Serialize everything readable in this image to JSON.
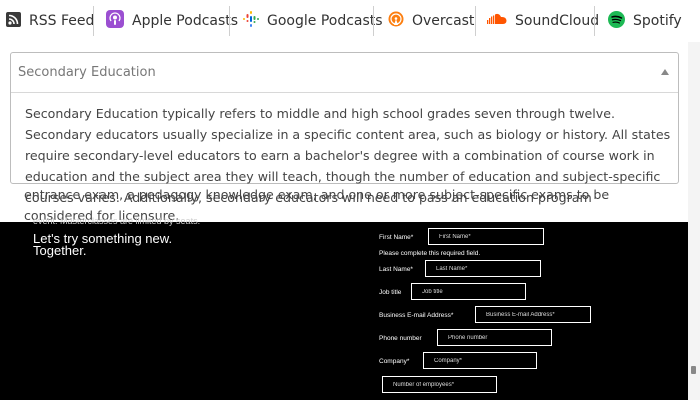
{
  "podcast_bar": {
    "items": [
      {
        "label": "RSS Feed",
        "icon": "rss-icon"
      },
      {
        "label": "Apple Podcasts",
        "icon": "apple-podcasts-icon"
      },
      {
        "label": "Google Podcasts",
        "icon": "google-podcasts-icon"
      },
      {
        "label": "Overcast",
        "icon": "overcast-icon"
      },
      {
        "label": "SoundCloud",
        "icon": "soundcloud-icon"
      },
      {
        "label": "Spotify",
        "icon": "spotify-icon"
      }
    ]
  },
  "accordion": {
    "title": "Secondary Education",
    "body": "Secondary Education typically refers to middle and high school grades seven through twelve. Secondary educators usually specialize in a specific content area, such as biology or history. All states require secondary-level educators to earn a bachelor's degree with a combination of course work in education and the subject area they will teach, though the number of education and subject-specific courses varies. Additionally, secondary educators will need to pass an education program",
    "overflow": "entrance exam, a pedagogy knowledge exam, and one or more subject-specific exams to be considered for licensure."
  },
  "form_section": {
    "cut_text": "event. Masterclasses are limited by seats.",
    "tagline_1": "Let's try something new.",
    "tagline_2": "Together.",
    "fields": {
      "first_name": {
        "label": "First Name*",
        "placeholder": "First Name*",
        "error": "Please complete this required field."
      },
      "last_name": {
        "label": "Last Name*",
        "placeholder": "Last Name*"
      },
      "job_title": {
        "label": "Job title",
        "placeholder": "Job title"
      },
      "email": {
        "label": "Business E-mail Address*",
        "placeholder": "Business E-mail Address*"
      },
      "phone": {
        "label": "Phone number",
        "placeholder": "Phone number"
      },
      "company": {
        "label": "Company*",
        "placeholder": "Company*"
      },
      "employees": {
        "placeholder": "Number of employees*"
      }
    }
  },
  "colors": {
    "apple_purple": "#9b4fd1",
    "overcast_orange": "#fc7e0f",
    "soundcloud_orange": "#ff5500",
    "spotify_green": "#1db954",
    "rss_dark": "#333333"
  }
}
